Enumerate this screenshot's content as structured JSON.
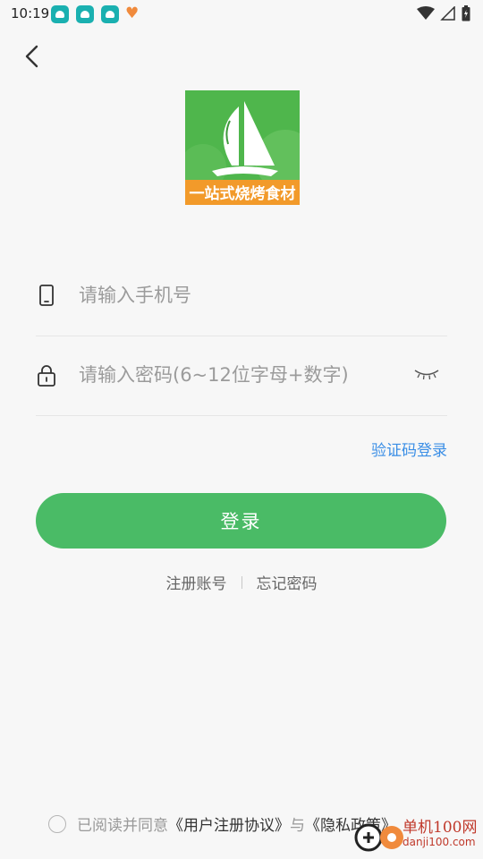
{
  "status_bar": {
    "time": "10:19"
  },
  "logo": {
    "brand_text": "一站式烧烤食材"
  },
  "form": {
    "phone_placeholder": "请输入手机号",
    "password_placeholder": "请输入密码(6~12位字母+数字)"
  },
  "links": {
    "code_login": "验证码登录",
    "register": "注册账号",
    "forgot_password": "忘记密码"
  },
  "login_button": "登录",
  "agreement": {
    "prefix": "已阅读并同意",
    "user_agreement": "《用户注册协议》",
    "conjunction": "与",
    "privacy_policy": "《隐私政策》"
  },
  "watermark": {
    "site_cn": "单机100网",
    "site_url": "danji100.com"
  },
  "colors": {
    "primary_green": "#4abb66",
    "link_blue": "#3a8ee6",
    "background": "#f7f7f7"
  }
}
